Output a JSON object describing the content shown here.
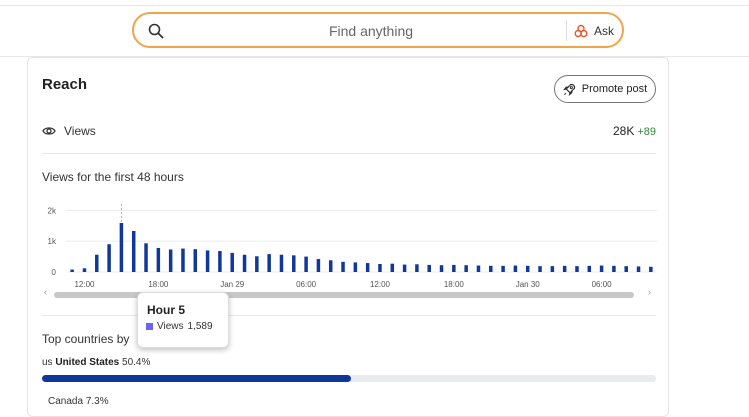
{
  "search": {
    "placeholder": "Find anything",
    "ask_label": "Ask"
  },
  "colors": {
    "accent_bar": "#10389c",
    "search_border": "#f2a44a",
    "positive": "#2e8b3d",
    "tooltip_swatch": "#6b63f5"
  },
  "card": {
    "title": "Reach",
    "promote_label": "Promote post",
    "views_label": "Views",
    "views_value": "28K",
    "views_delta": "+89",
    "chart_title": "Views for the first 48 hours",
    "countries_title": "Top countries by"
  },
  "chart_data": {
    "type": "bar",
    "series": [
      {
        "name": "Views",
        "values": [
          80,
          120,
          560,
          900,
          1589,
          1330,
          930,
          780,
          730,
          760,
          740,
          700,
          680,
          620,
          560,
          510,
          580,
          560,
          540,
          500,
          420,
          380,
          330,
          310,
          290,
          260,
          270,
          240,
          250,
          230,
          220,
          230,
          220,
          210,
          200,
          200,
          210,
          200,
          190,
          190,
          200,
          190,
          200,
          210,
          200,
          190,
          180,
          170
        ]
      }
    ],
    "ylim": [
      0,
      2400
    ],
    "yticks": [
      {
        "value": 0,
        "label": "0"
      },
      {
        "value": 1000,
        "label": "1k"
      },
      {
        "value": 2000,
        "label": "2k"
      }
    ],
    "xticks": [
      {
        "index": 1,
        "label": "12:00"
      },
      {
        "index": 7,
        "label": "18:00"
      },
      {
        "index": 13,
        "label": "Jan 29"
      },
      {
        "index": 19,
        "label": "06:00"
      },
      {
        "index": 25,
        "label": "12:00"
      },
      {
        "index": 31,
        "label": "18:00"
      },
      {
        "index": 37,
        "label": "Jan 30"
      },
      {
        "index": 43,
        "label": "06:00"
      }
    ],
    "hover_index": 4
  },
  "tooltip": {
    "title": "Hour 5",
    "series": "Views",
    "value": "1,589"
  },
  "countries": [
    {
      "code": "us",
      "name": "United States",
      "share": "50.4%",
      "fraction": 0.504
    },
    {
      "code": "",
      "name": "Canada",
      "share": "7.3%",
      "fraction": 0.073
    }
  ]
}
